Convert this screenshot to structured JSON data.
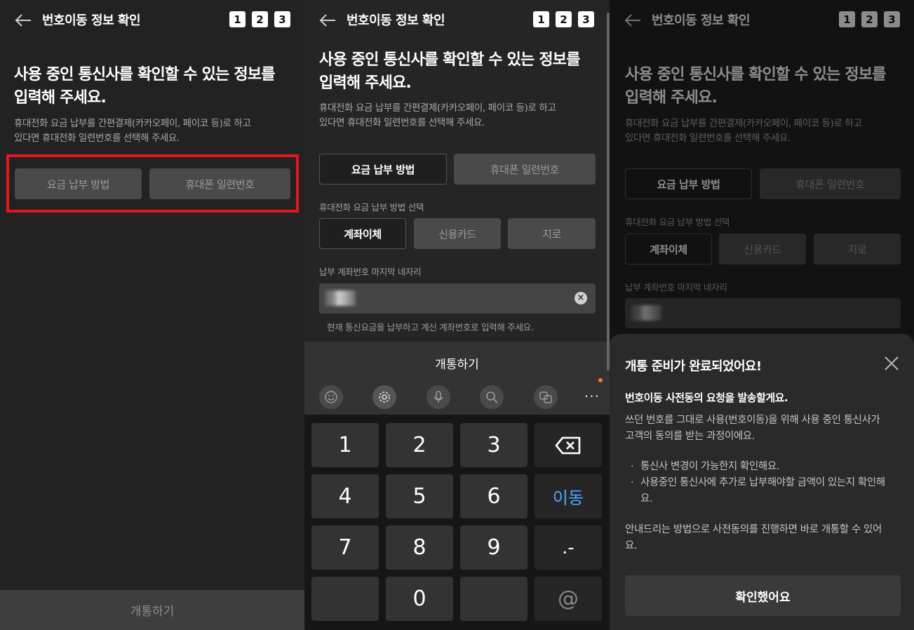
{
  "header": {
    "title": "번호이동 정보 확인",
    "steps": [
      "1",
      "2",
      "3"
    ]
  },
  "content": {
    "headline_line1": "사용 중인 통신사를 확인할 수 있는 정보를",
    "headline_line2": "입력해 주세요.",
    "desc_line1": "휴대전화 요금 납부를 간편결제(카카오페이, 페이코 등)로 하고",
    "desc_line2": "있다면 휴대전화 일련번호를 선택해 주세요.",
    "option_payment": "요금 납부 방법",
    "option_serial": "휴대폰 일련번호",
    "method_label": "휴대전화 요금 납부 방법 선택",
    "methods": [
      "계좌이체",
      "신용카드",
      "지로"
    ],
    "account_label": "납부 계좌번호 마지막 네자리",
    "account_hint": "현재 통신요금을 납부하고 계신 계좌번호로 입력해 주세요.",
    "submit": "개통하기"
  },
  "keyboard": {
    "title": "개통하기",
    "toolbar_icons": [
      "emoji-icon",
      "settings-icon",
      "mic-icon",
      "search-icon",
      "translate-icon",
      "more-icon"
    ],
    "more_label": "···",
    "keys": [
      [
        "1",
        "2",
        "3",
        "⌫"
      ],
      [
        "4",
        "5",
        "6",
        "이동"
      ],
      [
        "7",
        "8",
        "9",
        ".-"
      ],
      [
        "",
        "0",
        "",
        "@"
      ]
    ]
  },
  "sheet": {
    "title": "개통 준비가 완료되었어요!",
    "subtitle": "번호이동 사전동의 요청을 발송할게요.",
    "body_line1": "쓰던 번호를 그대로 사용(번호이동)을 위해 사용 중인 통신사가",
    "body_line2": "고객의 동의를 받는 과정이에요.",
    "bullet1": "통신사 변경이 가능한지 확인해요.",
    "bullet2_line1": "사용중인 통신사에 추가로 납부해야할 금액이 있는지 확인해",
    "bullet2_line2": "요.",
    "footer_line1": "안내드리는 방법으로 사전동의를 진행하면 바로 개통할 수 있어",
    "footer_line2": "요.",
    "confirm": "확인했어요"
  },
  "colors": {
    "highlight": "#e6151f",
    "accent_blue": "#4aa6ff",
    "notification_dot": "#ff7a1a"
  }
}
